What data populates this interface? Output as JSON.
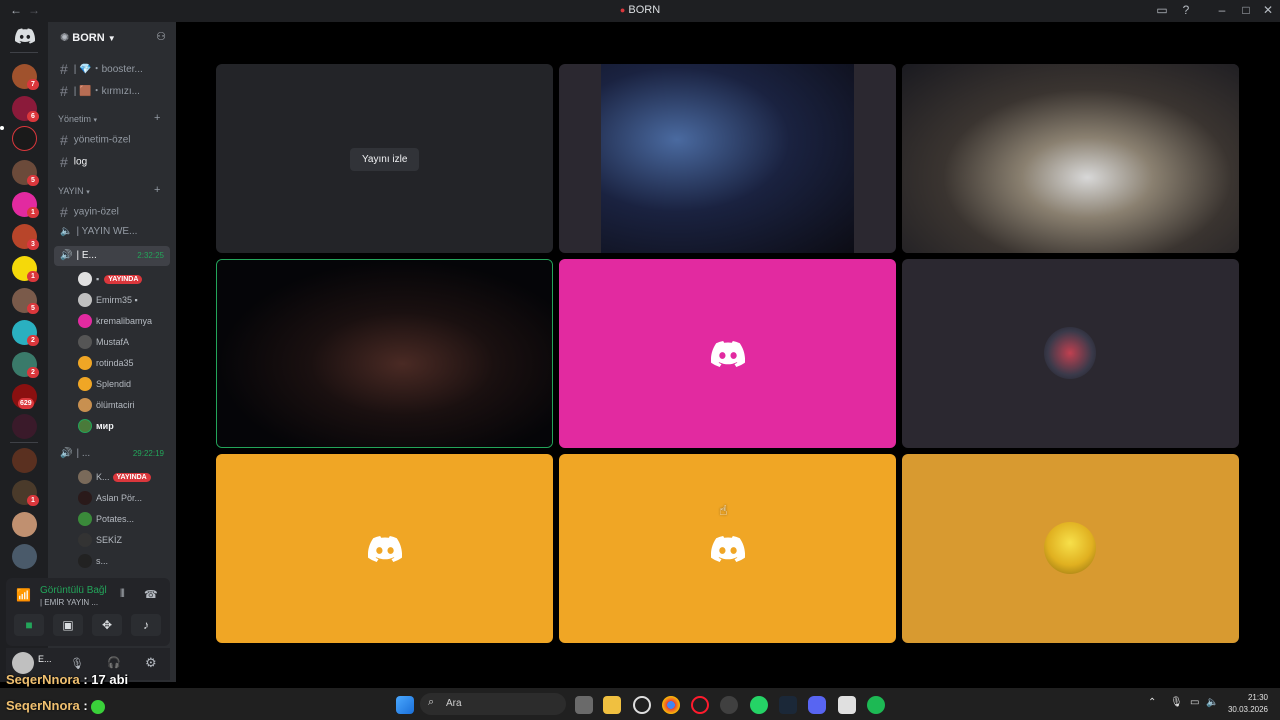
{
  "window": {
    "title": "BORN"
  },
  "server": {
    "name": "BORN"
  },
  "channels": [
    {
      "name": "| 💎・booster..."
    },
    {
      "name": "| 🟫・kırmızı..."
    }
  ],
  "categories": {
    "management": "Yönetim",
    "stream": "YAYIN"
  },
  "text_channels": {
    "mgmt_private": "yönetim-özel",
    "log": "log",
    "stream_private": "yayin-özel"
  },
  "voice": {
    "channel1": "| YAYIN WE...",
    "channel2": "| E...",
    "channel2_time": "2:32:25",
    "channel3": "| ...",
    "channel3_time": "29:22:19"
  },
  "users1": [
    {
      "name": "",
      "badge": "YAYINDA"
    },
    {
      "name": "Emirm35"
    },
    {
      "name": "kremalibamya"
    },
    {
      "name": "MustafA"
    },
    {
      "name": "rotinda35"
    },
    {
      "name": "Splendid"
    },
    {
      "name": "ölümtaciri"
    },
    {
      "name": "мир"
    }
  ],
  "users2": [
    {
      "name": "K...",
      "badge": "YAYINDA"
    },
    {
      "name": "Aslan Pör..."
    },
    {
      "name": "Potates..."
    },
    {
      "name": "SEKİZ"
    },
    {
      "name": "s..."
    }
  ],
  "voice_panel": {
    "status": "Görüntülü Bağl",
    "channel": "| EMİR YAYIN ..."
  },
  "user_panel": {
    "name": "E..."
  },
  "stage": {
    "watch_stream": "Yayını izle"
  },
  "chat_overlay": [
    {
      "user": "SeqerNnora",
      "text": ": 17 abi"
    },
    {
      "user": "SeqerNnora",
      "text": ":"
    }
  ],
  "taskbar": {
    "search": "Ara",
    "time": "21:30",
    "date": "30.03.2026"
  },
  "guild_badges": [
    "7",
    "6",
    "",
    "5",
    "1",
    "3",
    "1",
    "5",
    "2",
    "2",
    "629",
    "",
    "",
    "1"
  ],
  "colors": {
    "pink_tile": "#e22aa0",
    "orange_tile": "#f0a625",
    "dark_tile": "#2b2830",
    "gray_tile": "#232428",
    "accent": "#5865f2"
  }
}
